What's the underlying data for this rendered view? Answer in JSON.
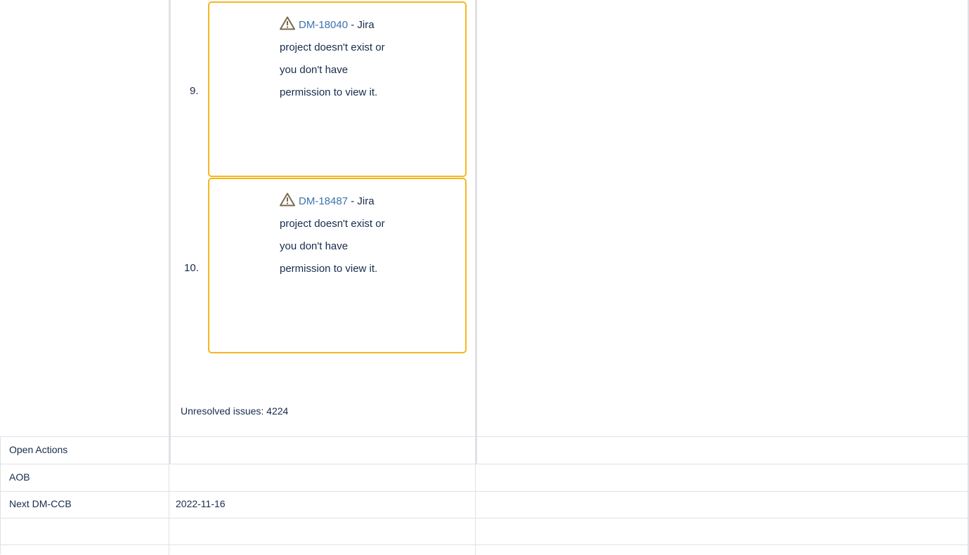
{
  "issues": [
    {
      "number": "9.",
      "key": "DM-18040",
      "message_lines": [
        " - Jira",
        "project doesn't exist or",
        "you don't have",
        "permission to view it."
      ]
    },
    {
      "number": "10.",
      "key": "DM-18487",
      "message_lines": [
        " - Jira",
        "project doesn't exist or",
        "you don't have",
        "permission to view it."
      ]
    }
  ],
  "unresolved_label": "Unresolved issues: 4224",
  "rows": [
    {
      "label": "Open Actions",
      "value": "",
      "notes": ""
    },
    {
      "label": "AOB",
      "value": "",
      "notes": ""
    },
    {
      "label": "Next DM-CCB",
      "value": "2022-11-16",
      "notes": ""
    }
  ],
  "colors": {
    "card_border": "#f6b621",
    "link": "#3b73af",
    "grid": "#dfe1e6",
    "text": "#172b4d"
  },
  "icons": [
    "warning-icon"
  ]
}
